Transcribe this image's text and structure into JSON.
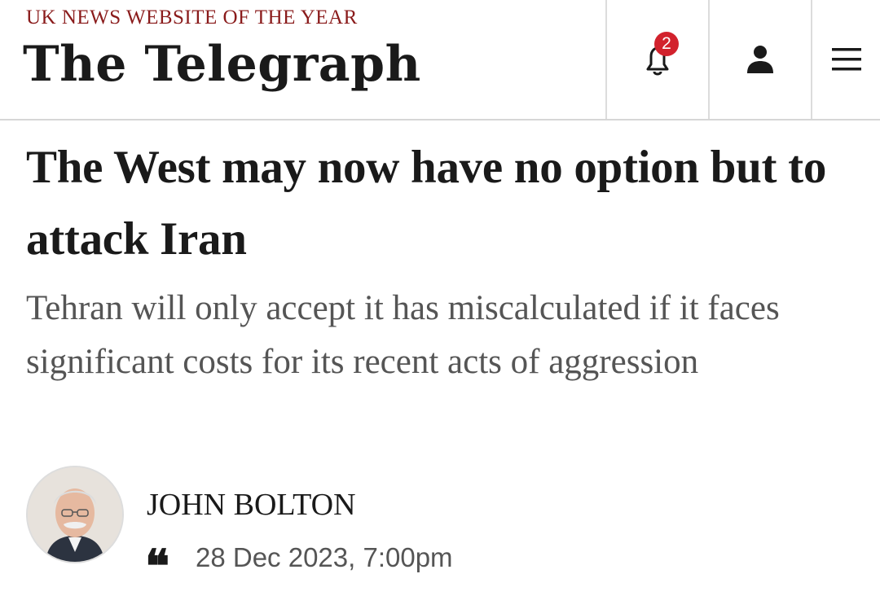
{
  "header": {
    "tagline": "UK NEWS WEBSITE OF THE YEAR",
    "logo": "The Telegraph",
    "notifications": {
      "icon": "bell-icon",
      "count": "2",
      "badge_color": "#d2222d"
    },
    "account": {
      "icon": "user-icon"
    },
    "menu": {
      "icon": "hamburger-menu-icon"
    }
  },
  "article": {
    "headline": "The West may now have no option but to attack Iran",
    "standfirst": "Tehran will only accept it has miscalculated if it faces significant costs for its recent acts of aggression",
    "author": "JOHN BOLTON",
    "comment_icon": "quote-icon",
    "date": "28 Dec 2023, 7:00pm"
  },
  "colors": {
    "tagline": "#8a1b1b",
    "text": "#1a1a1a",
    "standfirst": "#555555"
  }
}
